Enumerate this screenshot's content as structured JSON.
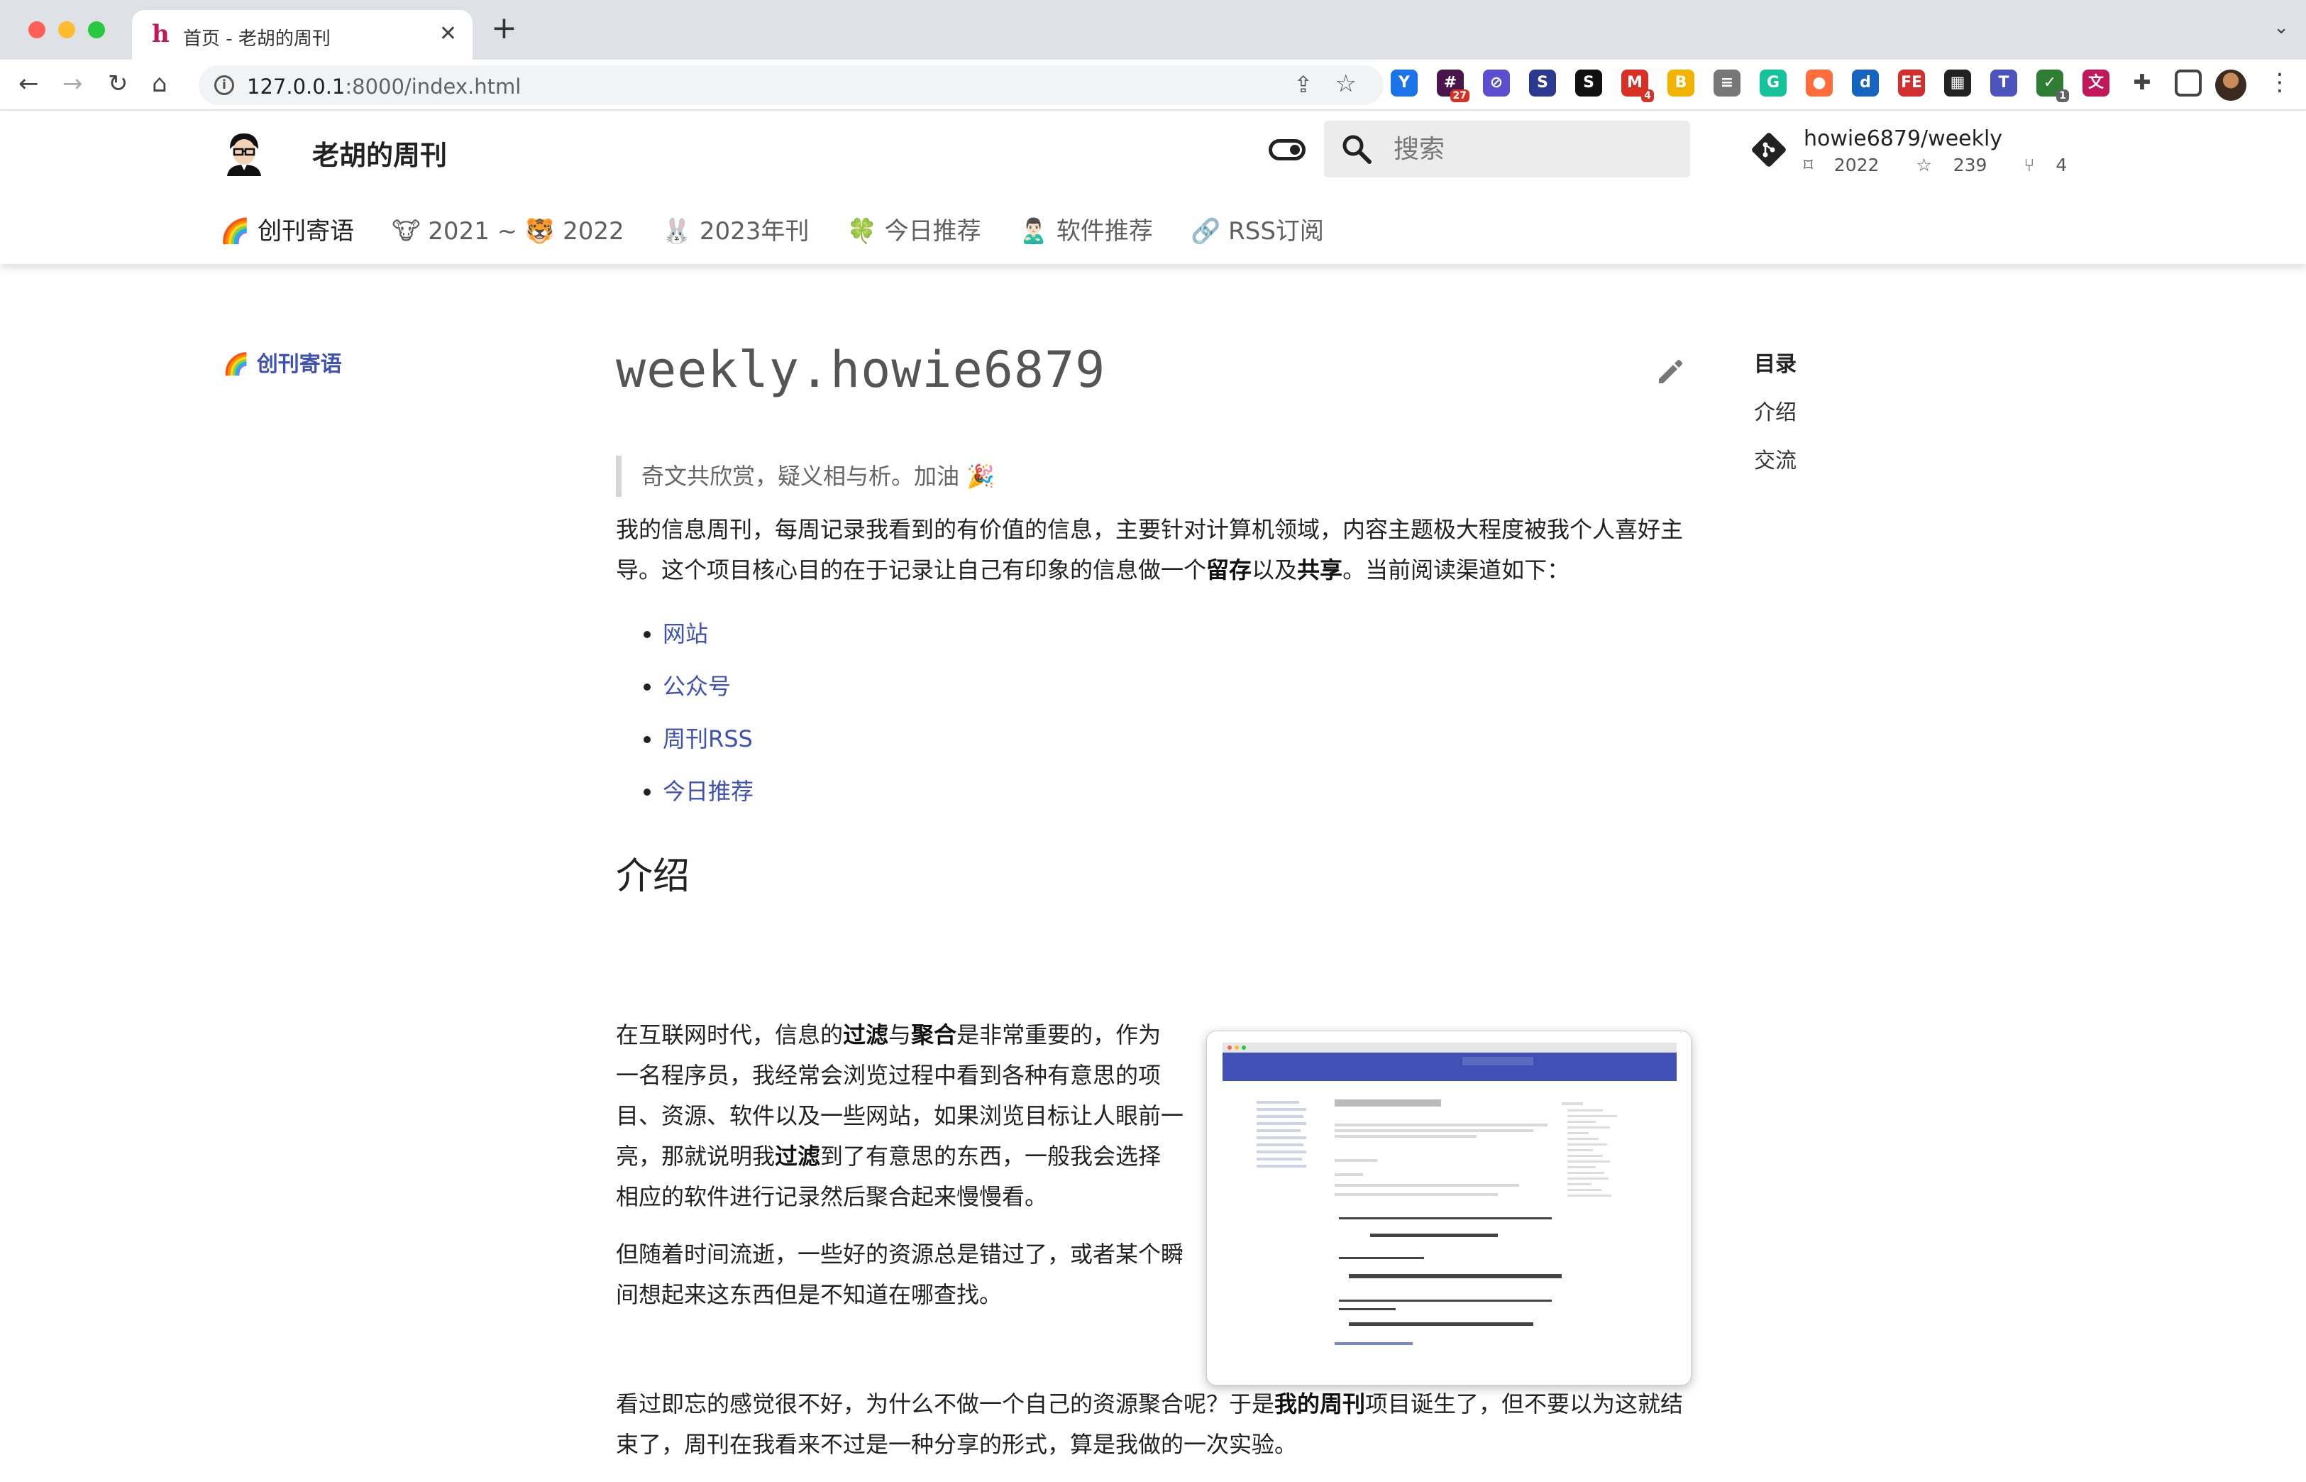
{
  "browser": {
    "tab_favicon": "h",
    "tab_title": "首页 - 老胡的周刊",
    "url_host": "127.0.0.1",
    "url_path": ":8000/index.html",
    "extensions": [
      {
        "name": "ext-y-icon",
        "color": "#1a73e8",
        "glyph": "Y"
      },
      {
        "name": "ext-slack-icon",
        "color": "#4a154b",
        "glyph": "#",
        "badge": "27"
      },
      {
        "name": "ext-link-icon",
        "color": "#5b4fcf",
        "glyph": "⊘"
      },
      {
        "name": "ext-s-icon",
        "color": "#2b3a8f",
        "glyph": "S"
      },
      {
        "name": "ext-s2-icon",
        "color": "#111111",
        "glyph": "S"
      },
      {
        "name": "ext-gmail-icon",
        "color": "#d93025",
        "glyph": "M",
        "badge": "4"
      },
      {
        "name": "ext-book-icon",
        "color": "#f2b400",
        "glyph": "B"
      },
      {
        "name": "ext-reader-icon",
        "color": "#777777",
        "glyph": "≡"
      },
      {
        "name": "ext-grammarly-icon",
        "color": "#15c39a",
        "glyph": "G"
      },
      {
        "name": "ext-fire-icon",
        "color": "#ff6d3a",
        "glyph": "●"
      },
      {
        "name": "ext-d-icon",
        "color": "#1565c0",
        "glyph": "d"
      },
      {
        "name": "ext-fe-icon",
        "color": "#d32f2f",
        "glyph": "FE"
      },
      {
        "name": "ext-table-icon",
        "color": "#222222",
        "glyph": "▦"
      },
      {
        "name": "ext-teams-icon",
        "color": "#4b53bc",
        "glyph": "T"
      },
      {
        "name": "ext-shield-icon",
        "color": "#2e7d32",
        "glyph": "✓",
        "badge": "1",
        "badge_style": "grey"
      },
      {
        "name": "ext-translate-icon",
        "color": "#c2185b",
        "glyph": "文"
      },
      {
        "name": "extensions-puzzle-icon",
        "color": "#ffffff",
        "glyph": "✚"
      }
    ]
  },
  "site": {
    "title": "老胡的周刊",
    "search_placeholder": "搜索",
    "repo_name": "howie6879/weekly",
    "repo_tag": "2022",
    "repo_stars": "239",
    "repo_forks": "4",
    "nav_tabs": [
      {
        "label": "🌈 创刊寄语",
        "active": true
      },
      {
        "label": "🐮 2021 ~ 🐯 2022",
        "active": false
      },
      {
        "label": "🐰 2023年刊",
        "active": false
      },
      {
        "label": "🍀 今日推荐",
        "active": false
      },
      {
        "label": "🙎🏻‍♂️ 软件推荐",
        "active": false
      },
      {
        "label": "🔗 RSS订阅",
        "active": false
      }
    ]
  },
  "sidebar": {
    "link": "🌈 创刊寄语"
  },
  "toc": {
    "title": "目录",
    "items": [
      "介绍",
      "交流"
    ]
  },
  "content": {
    "title": "weekly.howie6879",
    "quote": "奇文共欣赏，疑义相与析。加油 🎉",
    "intro_p1_a": "我的信息周刊，每周记录我看到的有价值的信息，主要针对计算机领域，内容主题极大程度被我个人喜好主导。这个项目核心目的在于记录让自己有印象的信息做一个",
    "intro_p1_b1": "留存",
    "intro_p1_mid": "以及",
    "intro_p1_b2": "共享",
    "intro_p1_c": "。当前阅读渠道如下：",
    "links": [
      "网站",
      "公众号",
      "周刊RSS",
      "今日推荐"
    ],
    "section_heading": "介绍",
    "p2_a": "在互联网时代，信息的",
    "p2_b1": "过滤",
    "p2_mid": "与",
    "p2_b2": "聚合",
    "p2_c": "是非常重要的，作为一名程序员，我经常会浏览过程中看到各种有意思的项目、资源、软件以及一些网站，如果浏览目标让人眼前一亮，那就说明我",
    "p2_b3": "过滤",
    "p2_d": "到了有意思的东西，一般我会选择相应的软件进行记录然后聚合起来慢慢看。",
    "p3": "但随着时间流逝，一些好的资源总是错过了，或者某个瞬间想起来这东西但是不知道在哪查找。",
    "p4_a": "看过即忘的感觉很不好，为什么不做一个自己的资源聚合呢？于是",
    "p4_b": "我的周刊",
    "p4_c": "项目诞生了，但不要以为这就结束了，周刊在我看来不过是一种分享的形式，算是我做的一次实验。"
  },
  "colors": {
    "accent": "#3f51b5",
    "header_bar": "#3f51b5"
  }
}
